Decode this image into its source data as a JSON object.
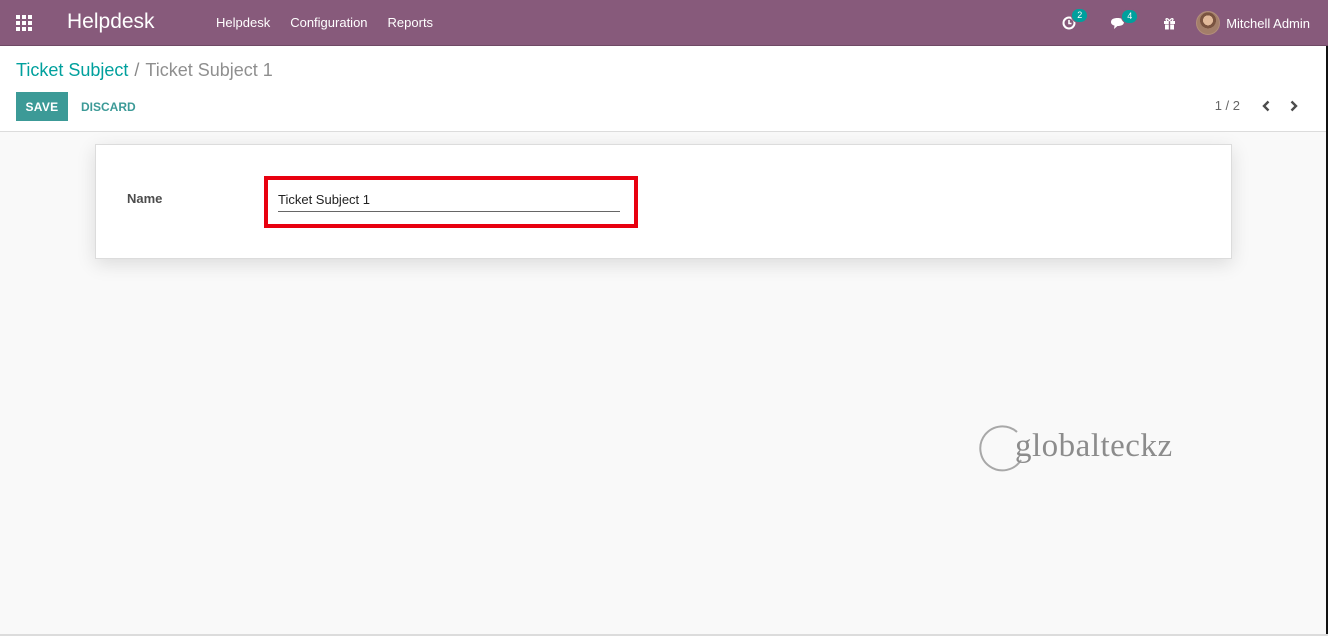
{
  "navbar": {
    "app_title": "Helpdesk",
    "menu": [
      "Helpdesk",
      "Configuration",
      "Reports"
    ],
    "activity_count": "2",
    "messages_count": "4",
    "user_name": "Mitchell Admin"
  },
  "breadcrumb": {
    "parent": "Ticket Subject",
    "separator": "/",
    "current": "Ticket Subject 1"
  },
  "buttons": {
    "save": "SAVE",
    "discard": "DISCARD"
  },
  "pager": {
    "value": "1 / 2"
  },
  "form": {
    "name_label": "Name",
    "name_value": "Ticket Subject 1"
  },
  "watermark": {
    "text": "globalteckz"
  },
  "colors": {
    "navbar": "#875a7b",
    "primary": "#00a09d",
    "highlight": "#e8000f"
  }
}
